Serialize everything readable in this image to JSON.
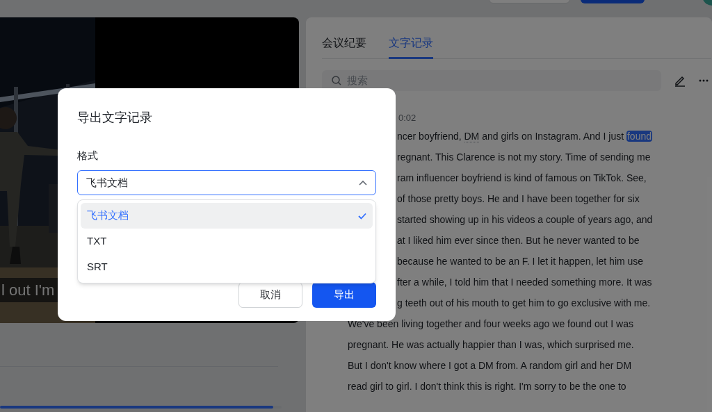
{
  "video": {
    "subtitle": "l out I'm"
  },
  "tabs": [
    {
      "label": "会议纪要",
      "selected": false
    },
    {
      "label": "文字记录",
      "selected": true
    }
  ],
  "search": {
    "placeholder": "搜索"
  },
  "transcript": {
    "timestamp": "0:02",
    "line_tails": [
      [
        {
          "kind": "plain",
          "text": "ncer boyfriend, "
        },
        {
          "kind": "keyword",
          "text": "DM"
        },
        {
          "kind": "plain",
          "text": " and girls on Instagram. And I just "
        },
        {
          "kind": "match",
          "text": "found"
        }
      ],
      [
        {
          "kind": "plain",
          "text": "regnant. This Clarence is not my story. Time of sending me"
        }
      ],
      [
        {
          "kind": "plain",
          "text": "ram influencer boyfriend is kind of famous on TikTok. See,"
        }
      ],
      [
        {
          "kind": "plain",
          "text": "of those pretty boys. He and I have been together for six"
        }
      ],
      [
        {
          "kind": "plain",
          "text": "started showing up in his videos a couple of years ago, and"
        }
      ],
      [
        {
          "kind": "plain",
          "text": "at I liked him ever since then. But he never wanted to be"
        }
      ],
      [
        {
          "kind": "plain",
          "text": "because he wanted to be an F. I let it happen, let him use"
        }
      ],
      [
        {
          "kind": "plain",
          "text": "fter a while, I told him that I needed something more. It was"
        }
      ],
      [
        {
          "kind": "plain",
          "text": "g teeth out of his mouth to get him to go exclusive with me."
        }
      ]
    ],
    "lines": [
      "We've been living together and four weeks ago we found out I was",
      "pregnant. He was actually happier than I was, which surprised me.",
      "But I don't know where I got a DM from. A random girl and her DM",
      "read girl to girl. I don't think this is right. I'm sorry to be the one to"
    ]
  },
  "player": {
    "level": 0.97
  },
  "dialog": {
    "title": "导出文字记录",
    "field_label": "格式",
    "select_value": "飞书文档",
    "options": [
      {
        "label": "飞书文档",
        "selected": true
      },
      {
        "label": "TXT",
        "selected": false
      },
      {
        "label": "SRT",
        "selected": false
      }
    ],
    "buttons": [
      {
        "kind": "secondary",
        "label": "取消"
      },
      {
        "kind": "primary",
        "label": "导出"
      }
    ]
  }
}
